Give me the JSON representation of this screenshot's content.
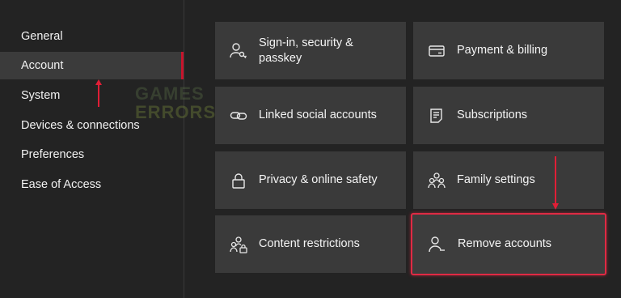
{
  "sidebar": {
    "items": [
      {
        "label": "General"
      },
      {
        "label": "Account"
      },
      {
        "label": "System"
      },
      {
        "label": "Devices & connections"
      },
      {
        "label": "Preferences"
      },
      {
        "label": "Ease of Access"
      }
    ],
    "selected": "Account"
  },
  "tiles": {
    "signin": {
      "label": "Sign-in, security & passkey",
      "icon": "user-key-icon"
    },
    "payment": {
      "label": "Payment & billing",
      "icon": "credit-card-icon"
    },
    "linked": {
      "label": "Linked social accounts",
      "icon": "link-icon"
    },
    "subscriptions": {
      "label": "Subscriptions",
      "icon": "document-list-icon"
    },
    "privacy": {
      "label": "Privacy & online safety",
      "icon": "lock-icon"
    },
    "family": {
      "label": "Family settings",
      "icon": "family-icon"
    },
    "content": {
      "label": "Content restrictions",
      "icon": "people-lock-icon"
    },
    "remove": {
      "label": "Remove accounts",
      "icon": "user-remove-icon"
    }
  },
  "watermark": {
    "line1": "GAMES",
    "line2": "ERRORS"
  },
  "colors": {
    "accent": "#c8142c",
    "highlight": "#e02a44",
    "background": "#232323",
    "tile": "#3a3a3a"
  }
}
